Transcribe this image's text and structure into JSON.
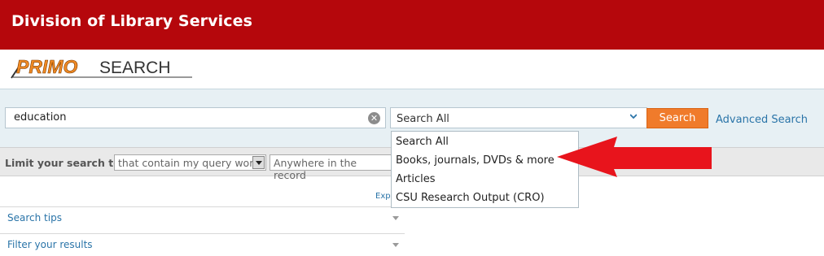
{
  "header": {
    "title": "Division of Library Services"
  },
  "logo": {
    "part1": "PRIMO",
    "part2": "SEARCH"
  },
  "search": {
    "query_value": "education",
    "scope_selected": "Search All",
    "search_button": "Search",
    "advanced_link": "Advanced Search"
  },
  "scope_dropdown": {
    "options": [
      "Search All",
      "Books, journals, DVDs & more",
      "Articles",
      "CSU Research Output (CRO)"
    ]
  },
  "limit": {
    "label": "Limit your search to:",
    "match_value": "that contain my query words",
    "field_value": "Anywhere in the record"
  },
  "results": {
    "expand_link": "Exp"
  },
  "facets": {
    "search_tips": "Search tips",
    "filter_results": "Filter your results"
  },
  "colors": {
    "header_bg": "#b5070c",
    "search_button": "#f07b2b",
    "link": "#2a74a8",
    "annotation_arrow": "#e8141c"
  },
  "annotation": {
    "arrow_icon": "red-arrow-icon"
  }
}
